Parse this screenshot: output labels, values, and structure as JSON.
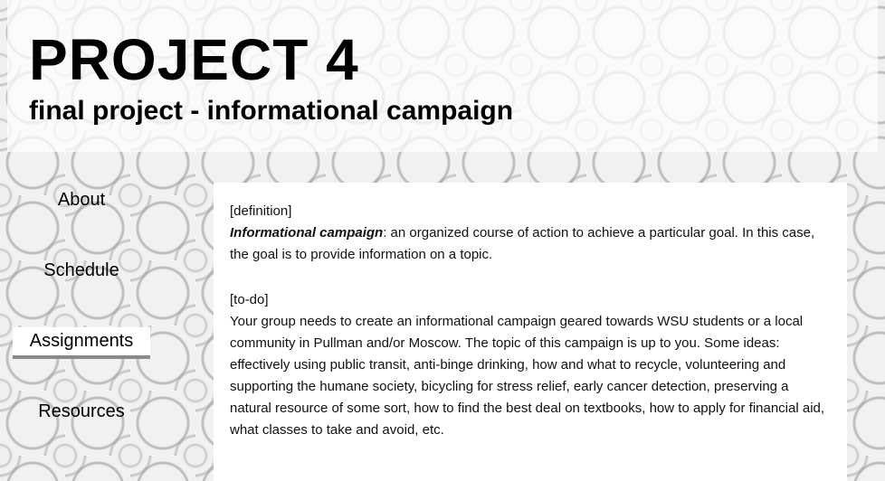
{
  "header": {
    "title": "PROJECT 4",
    "subtitle": "final project - informational campaign"
  },
  "nav": {
    "items": [
      {
        "label": "About"
      },
      {
        "label": "Schedule"
      },
      {
        "label": "Assignments",
        "active": true
      },
      {
        "label": "Resources"
      }
    ]
  },
  "content": {
    "definition": {
      "tag": "[definition]",
      "term": "Informational campaign",
      "text": ": an organized course of action to achieve a particular goal. In this case, the goal is to provide information on a topic."
    },
    "todo": {
      "tag": "[to-do]",
      "text": "Your group needs to create an informational campaign geared towards WSU students or a local community in Pullman and/or Moscow. The topic of this campaign is up to you. Some ideas: effectively using public transit, anti-binge drinking, how and what to recycle, volunteering and supporting the humane society, bicycling for stress relief, early cancer detection, preserving a natural resource of some sort, how to find the best deal on textbooks, how to apply for financial aid, what classes to take and avoid, etc."
    }
  },
  "colors": {
    "active_underline": "#8a8a8a",
    "panel": "#ffffff"
  }
}
